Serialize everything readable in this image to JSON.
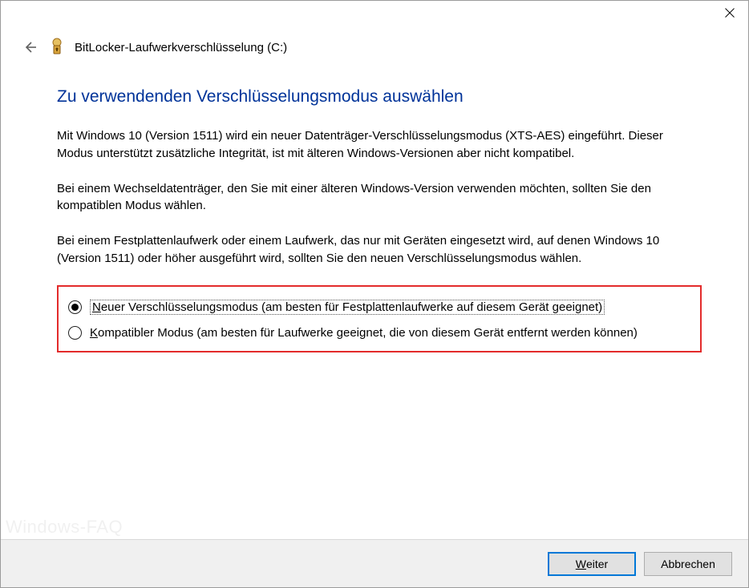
{
  "window": {
    "app_title": "BitLocker-Laufwerkverschlüsselung (C:)"
  },
  "heading": "Zu verwendenden Verschlüsselungsmodus auswählen",
  "paragraphs": {
    "p1": "Mit Windows 10 (Version 1511) wird ein neuer Datenträger-Verschlüsselungsmodus (XTS-AES) eingeführt. Dieser Modus unterstützt zusätzliche Integrität, ist mit älteren Windows-Versionen aber nicht kompatibel.",
    "p2": "Bei einem Wechseldatenträger, den Sie mit einer älteren Windows-Version verwenden möchten, sollten Sie den kompatiblen Modus wählen.",
    "p3": "Bei einem Festplattenlaufwerk oder einem Laufwerk, das nur mit Geräten eingesetzt wird, auf denen Windows 10 (Version 1511) oder höher ausgeführt wird, sollten Sie den neuen Verschlüsselungsmodus wählen."
  },
  "options": {
    "new_mode": {
      "mnemonic": "N",
      "rest": "euer Verschlüsselungsmodus (am besten für Festplattenlaufwerke auf diesem Gerät geeignet)",
      "selected": true
    },
    "compat_mode": {
      "mnemonic": "K",
      "rest": "ompatibler Modus (am besten für Laufwerke geeignet, die von diesem Gerät entfernt werden können)",
      "selected": false
    }
  },
  "buttons": {
    "next_mnemonic": "W",
    "next_rest": "eiter",
    "cancel": "Abbrechen"
  },
  "watermark": "Windows-FAQ"
}
